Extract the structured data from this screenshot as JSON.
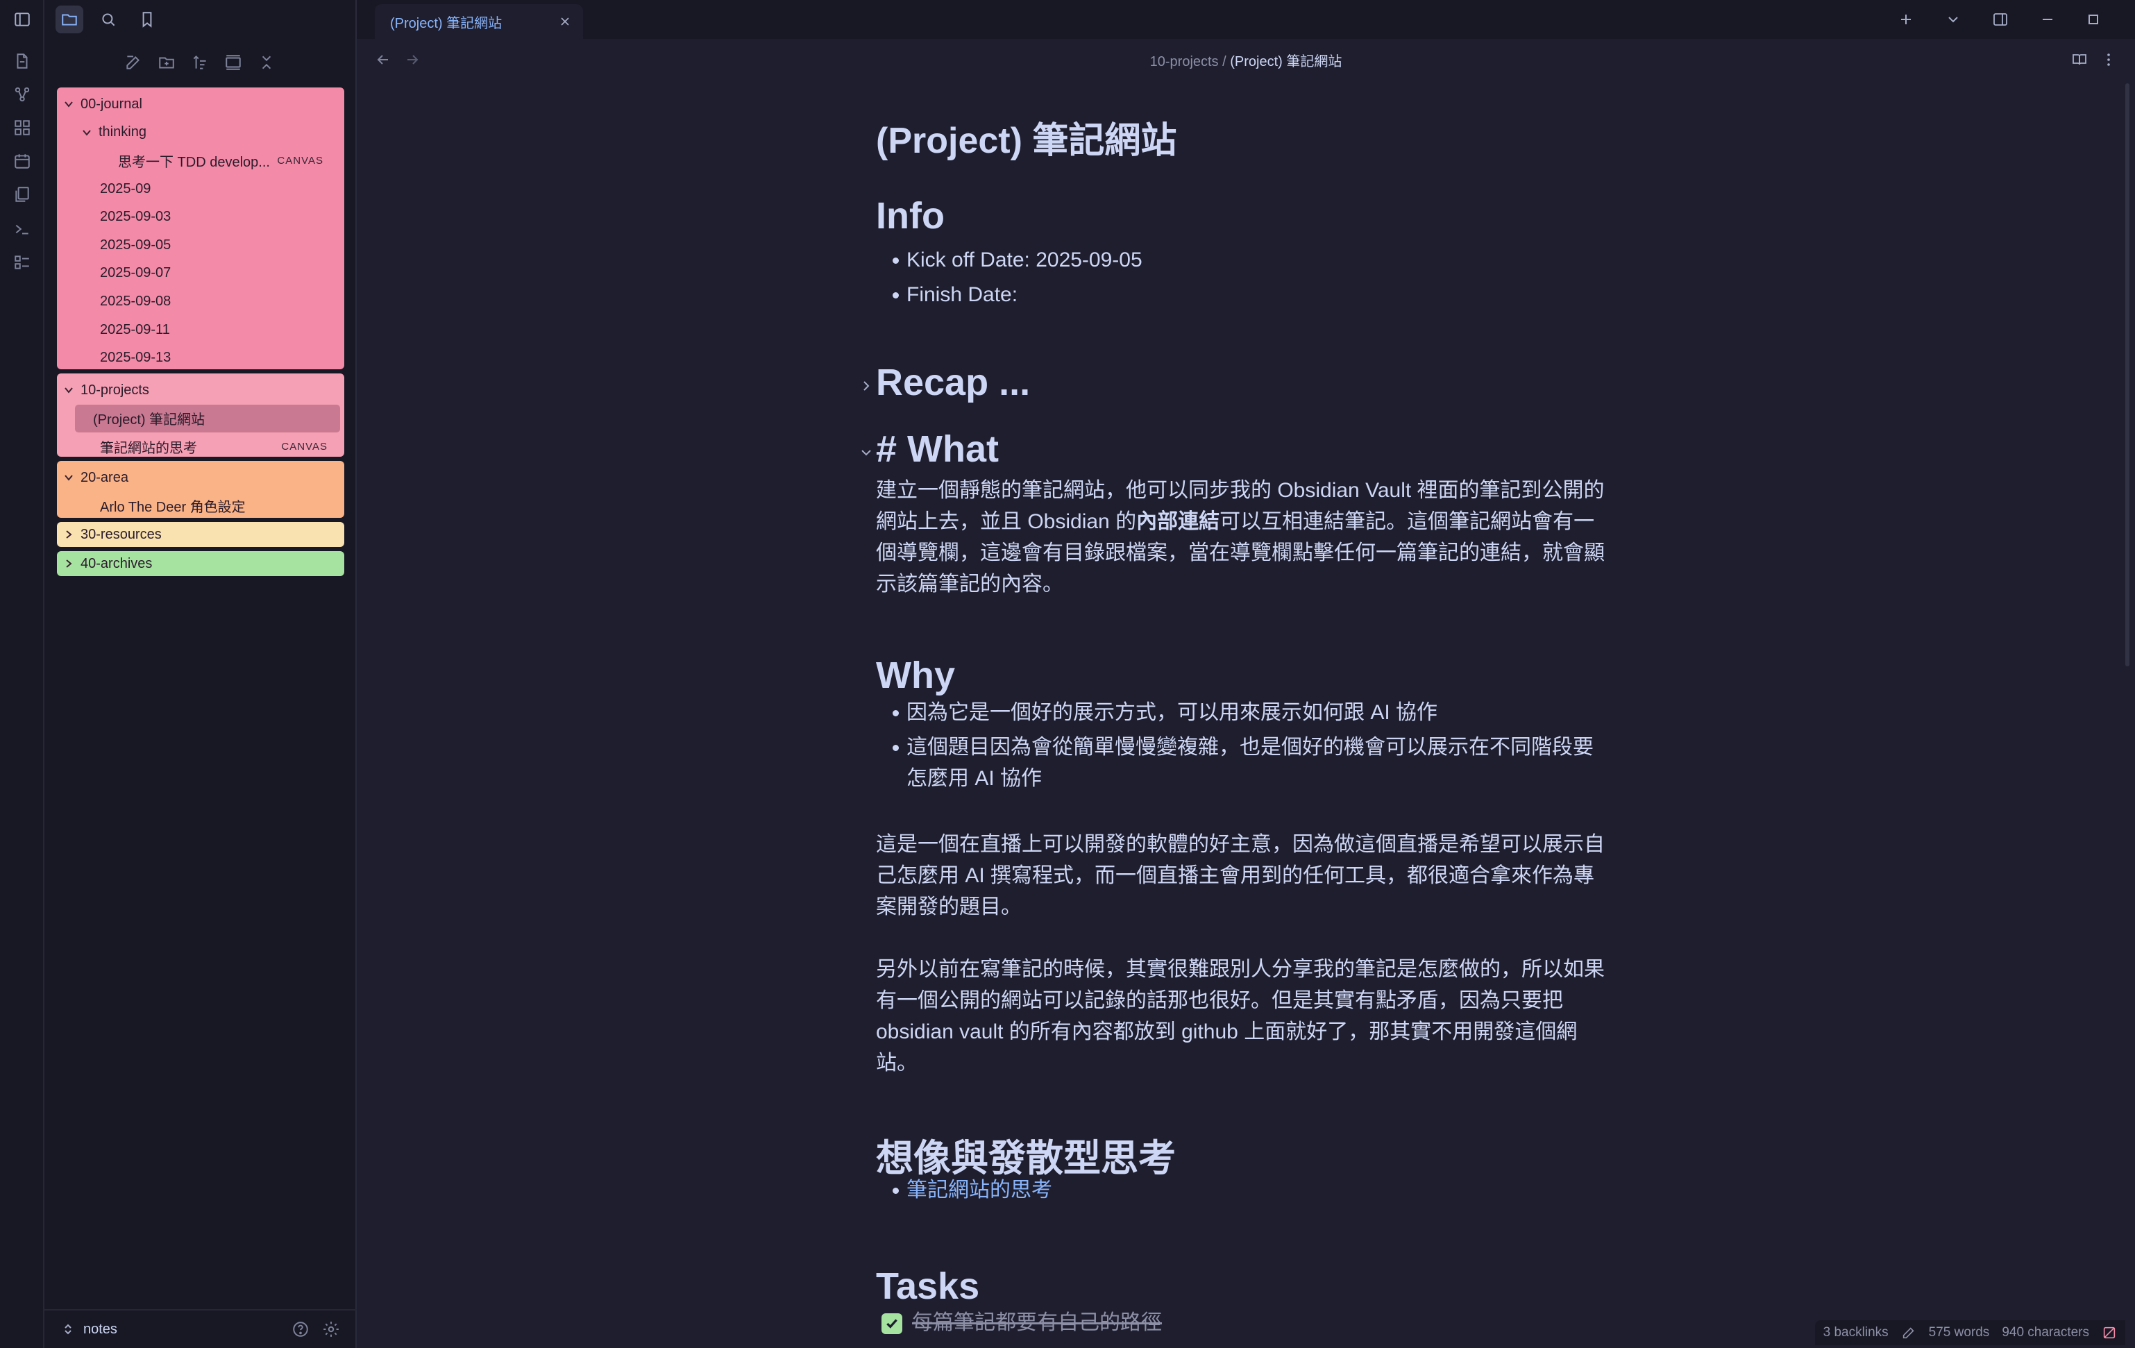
{
  "tab": {
    "title": "(Project) 筆記網站"
  },
  "breadcrumb": {
    "folder": "10-projects",
    "sep": "/",
    "current": "(Project) 筆記網站"
  },
  "sidebar": {
    "vault": "notes",
    "folders": [
      {
        "name": "00-journal",
        "color": "#f38ba8"
      },
      {
        "name": "10-projects",
        "color": "#f5a0b4"
      },
      {
        "name": "20-area",
        "color": "#fab387"
      },
      {
        "name": "30-resources",
        "color": "#f9e2af"
      },
      {
        "name": "40-archives",
        "color": "#a6e3a1"
      }
    ],
    "journal": {
      "thinking": "thinking",
      "canvas_file": "思考一下 TDD develop...",
      "canvas_tag": "CANVAS",
      "files": [
        "2025-09",
        "2025-09-03",
        "2025-09-05",
        "2025-09-07",
        "2025-09-08",
        "2025-09-11",
        "2025-09-13"
      ]
    },
    "projects": {
      "file1": "(Project) 筆記網站",
      "file2": "筆記網站的思考",
      "file2_tag": "CANVAS"
    },
    "area": {
      "file1": "Arlo The Deer 角色設定"
    }
  },
  "doc": {
    "title": "(Project) 筆記網站",
    "info_heading": "Info",
    "kickoff": "Kick off Date: 2025-09-05",
    "finish": "Finish Date:",
    "recap": "Recap ...",
    "what_heading": "# What",
    "what_p1": "建立一個靜態的筆記網站，他可以同步我的 Obsidian Vault 裡面的筆記到公開的網站上去，並且 Obsidian 的",
    "what_bold": "內部連結",
    "what_p2": "可以互相連結筆記。這個筆記網站會有一個導覽欄，這邊會有目錄跟檔案，當在導覽欄點擊任何一篇筆記的連結，就會顯示該篇筆記的內容。",
    "why_heading": "Why",
    "why_b1": "因為它是一個好的展示方式，可以用來展示如何跟 AI 協作",
    "why_b2": "這個題目因為會從簡單慢慢變複雜，也是個好的機會可以展示在不同階段要怎麼用 AI 協作",
    "why_p1": "這是一個在直播上可以開發的軟體的好主意，因為做這個直播是希望可以展示自己怎麼用 AI 撰寫程式，而一個直播主會用到的任何工具，都很適合拿來作為專案開發的題目。",
    "why_p2": "另外以前在寫筆記的時候，其實很難跟別人分享我的筆記是怎麼做的，所以如果有一個公開的網站可以記錄的話那也很好。但是其實有點矛盾，因為只要把 obsidian vault 的所有內容都放到 github 上面就好了，那其實不用開發這個網站。",
    "idea_heading": "想像與發散型思考",
    "idea_link": "筆記網站的思考",
    "tasks_heading": "Tasks",
    "task1": "每篇筆記都要有自己的路徑"
  },
  "status": {
    "backlinks": "3 backlinks",
    "words": "575 words",
    "chars": "940 characters"
  }
}
